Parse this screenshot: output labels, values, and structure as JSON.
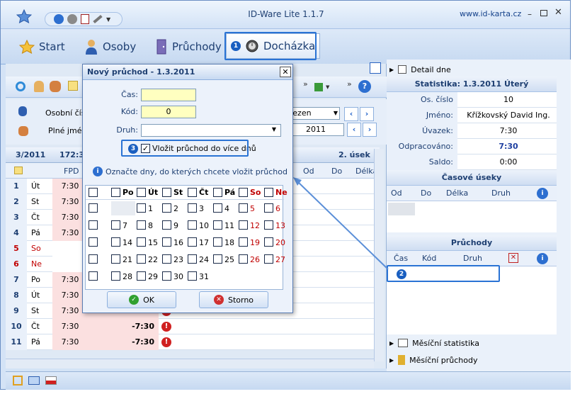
{
  "window": {
    "title": "ID-Ware Lite 1.1.7",
    "url": "www.id-karta.cz"
  },
  "nav": {
    "start": "Start",
    "persons": "Osoby",
    "passages": "Průchody",
    "attendance": "Docházka"
  },
  "callouts": {
    "one": "1",
    "two": "2",
    "three": "3"
  },
  "form": {
    "personal_no": "Osobní čísl",
    "full_name": "Plné jméno",
    "month": "řezen",
    "year": "2011"
  },
  "grid": {
    "period": "3/2011",
    "total": "172:3",
    "section": "2. úsek",
    "col_fpd": "FPD",
    "col_od": "Od",
    "col_do": "Do",
    "col_delka": "Délka",
    "rows": [
      {
        "n": "1",
        "d": "Út",
        "t": "7:30",
        "v": "",
        "weekend": false,
        "alert": false
      },
      {
        "n": "2",
        "d": "St",
        "t": "7:30",
        "v": "",
        "weekend": false,
        "alert": false
      },
      {
        "n": "3",
        "d": "Čt",
        "t": "7:30",
        "v": "",
        "weekend": false,
        "alert": false
      },
      {
        "n": "4",
        "d": "Pá",
        "t": "7:30",
        "v": "",
        "weekend": false,
        "alert": false
      },
      {
        "n": "5",
        "d": "So",
        "t": "",
        "v": "",
        "weekend": true,
        "alert": false
      },
      {
        "n": "6",
        "d": "Ne",
        "t": "",
        "v": "",
        "weekend": true,
        "alert": false
      },
      {
        "n": "7",
        "d": "Po",
        "t": "7:30",
        "v": "",
        "weekend": false,
        "alert": false
      },
      {
        "n": "8",
        "d": "Út",
        "t": "7:30",
        "v": "",
        "weekend": false,
        "alert": false
      },
      {
        "n": "9",
        "d": "St",
        "t": "7:30",
        "v": "",
        "weekend": false,
        "alert": true
      },
      {
        "n": "10",
        "d": "Čt",
        "t": "7:30",
        "v": "-7:30",
        "weekend": false,
        "alert": true
      },
      {
        "n": "11",
        "d": "Pá",
        "t": "7:30",
        "v": "-7:30",
        "weekend": false,
        "alert": true
      }
    ]
  },
  "right": {
    "detail": "Detail dne",
    "stats_title": "Statistika: 1.3.2011 Úterý",
    "stats": [
      {
        "k": "Os. číslo",
        "v": "10",
        "bold": false
      },
      {
        "k": "Jméno:",
        "v": "Křížkovský David Ing.",
        "bold": false
      },
      {
        "k": "Úvazek:",
        "v": "7:30",
        "bold": false
      },
      {
        "k": "Odpracováno:",
        "v": "7:30",
        "bold": true
      },
      {
        "k": "Saldo:",
        "v": "0:00",
        "bold": false
      }
    ],
    "time_sections": "Časové úseky",
    "ts_cols": [
      "Od",
      "Do",
      "Délka",
      "Druh"
    ],
    "passages": "Průchody",
    "p_cols": [
      "Čas",
      "Kód",
      "Druh"
    ],
    "monthly_stats": "Měsíční statistika",
    "monthly_passages": "Měsíční průchody"
  },
  "dialog": {
    "title": "Nový průchod - 1.3.2011",
    "cas_label": "Čas:",
    "kod_label": "Kód:",
    "druh_label": "Druh:",
    "kod_value": "0",
    "multi_label": "Vložit průchod do více dnů",
    "hint": "Označte dny, do kterých chcete vložit průchod",
    "weekdays": [
      "Po",
      "Út",
      "St",
      "Čt",
      "Pá",
      "So",
      "Ne"
    ],
    "weeks": [
      [
        "",
        "1",
        "2",
        "3",
        "4",
        "5",
        "6"
      ],
      [
        "7",
        "8",
        "9",
        "10",
        "11",
        "12",
        "13"
      ],
      [
        "14",
        "15",
        "16",
        "17",
        "18",
        "19",
        "20"
      ],
      [
        "21",
        "22",
        "23",
        "24",
        "25",
        "26",
        "27"
      ],
      [
        "28",
        "29",
        "30",
        "31",
        "",
        "",
        ""
      ]
    ],
    "ok": "OK",
    "cancel": "Storno"
  }
}
